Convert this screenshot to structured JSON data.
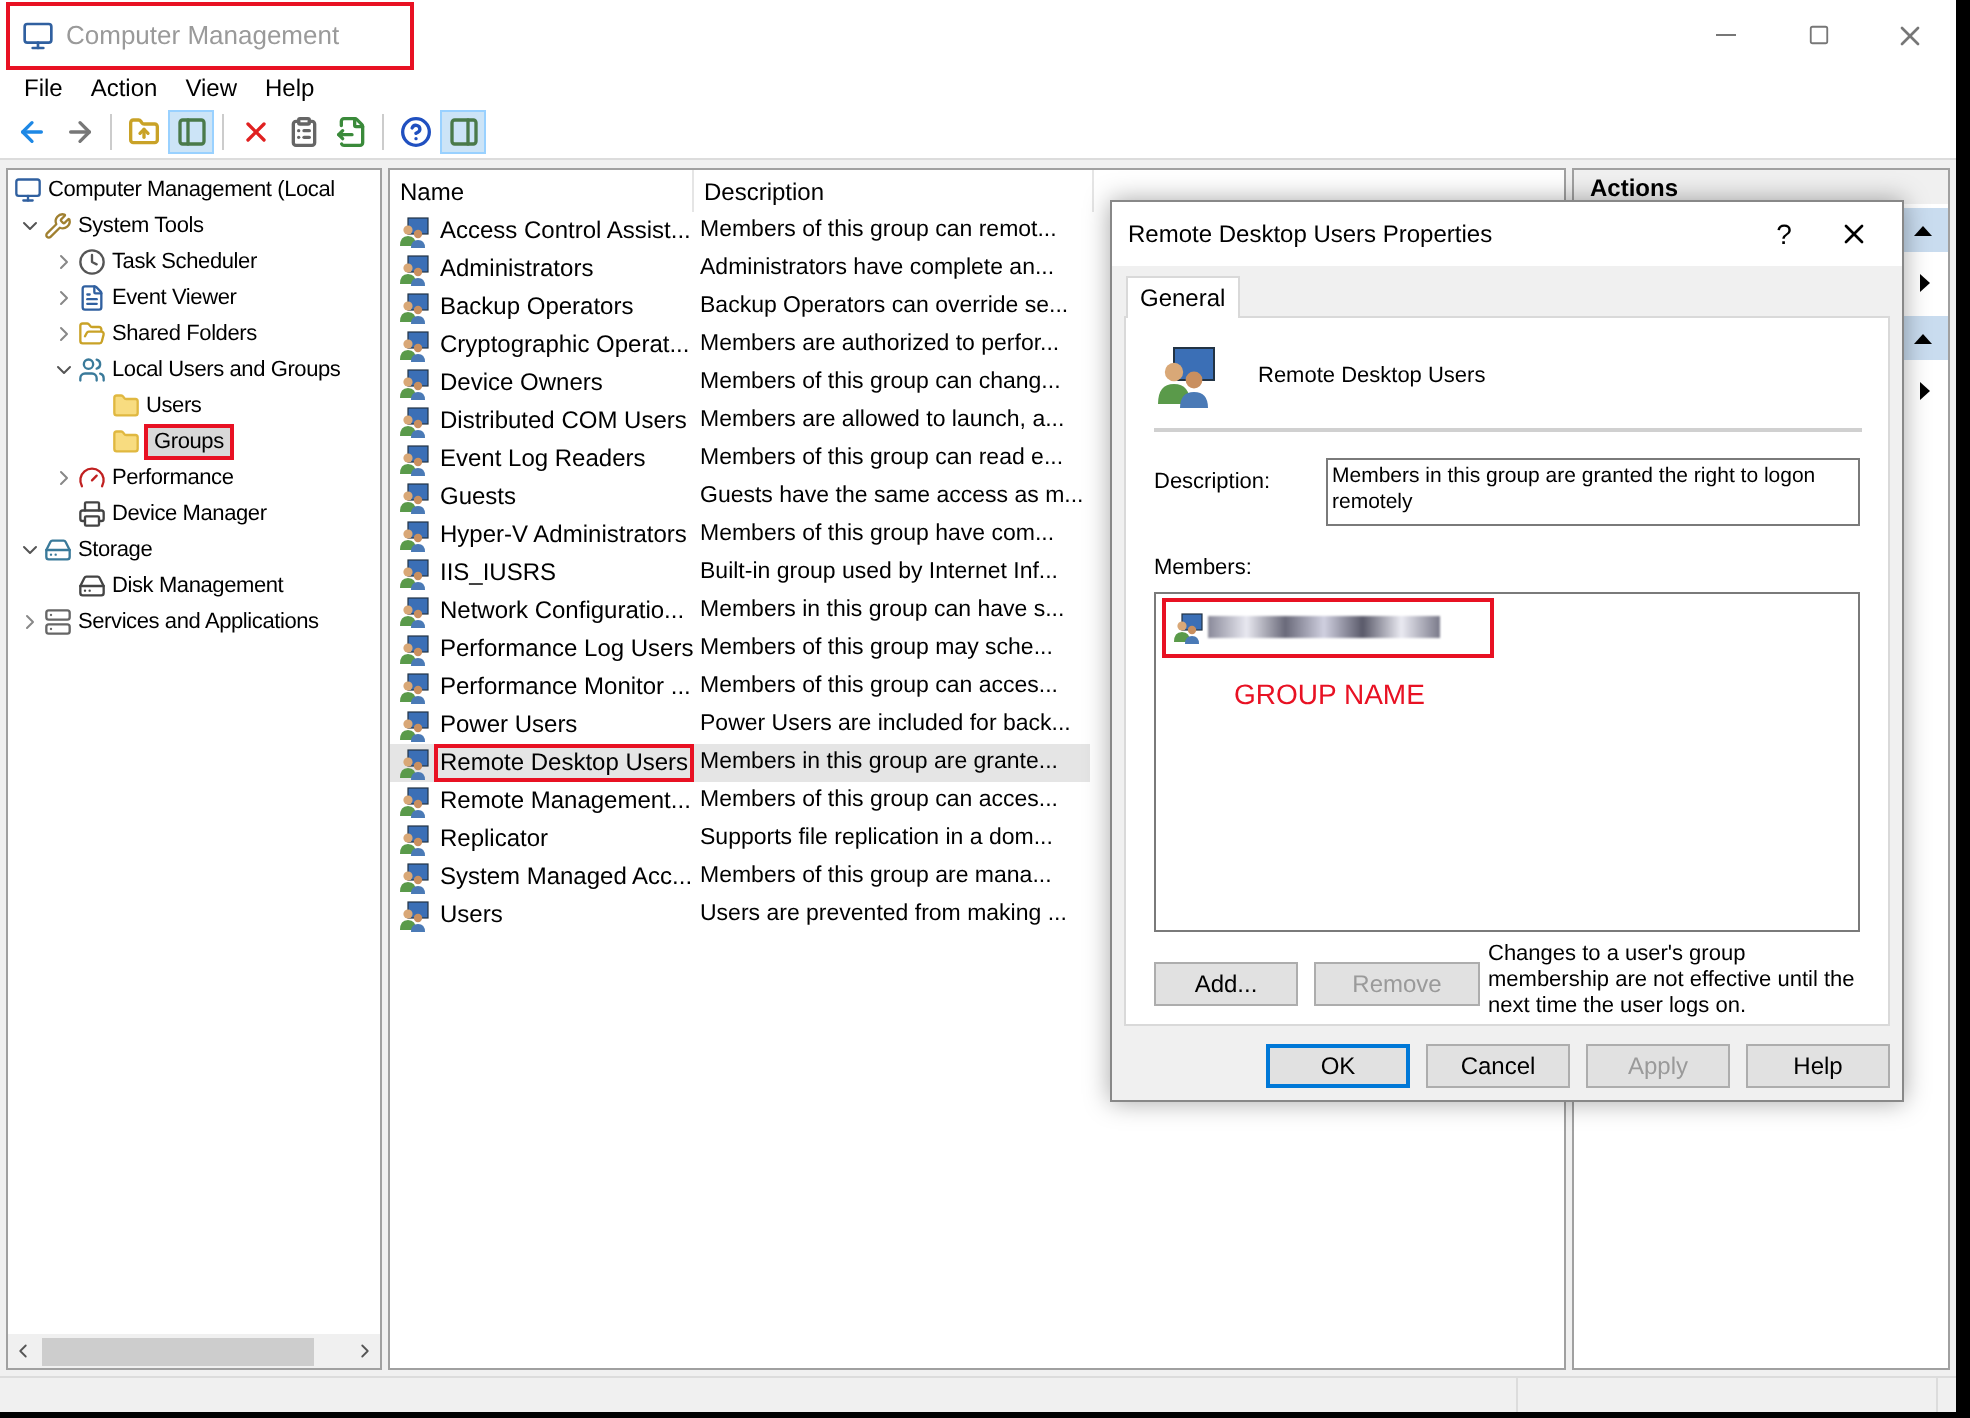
{
  "window": {
    "title": "Computer Management",
    "title_highlighted": true
  },
  "menu": [
    "File",
    "Action",
    "View",
    "Help"
  ],
  "toolbar": [
    {
      "kind": "back",
      "pressed": false
    },
    {
      "kind": "forward",
      "pressed": false
    },
    {
      "kind": "sep"
    },
    {
      "kind": "up",
      "pressed": false
    },
    {
      "kind": "tree",
      "pressed": true
    },
    {
      "kind": "sep"
    },
    {
      "kind": "delete",
      "pressed": false
    },
    {
      "kind": "properties",
      "pressed": false
    },
    {
      "kind": "export",
      "pressed": false
    },
    {
      "kind": "sep"
    },
    {
      "kind": "help",
      "pressed": false
    },
    {
      "kind": "pane",
      "pressed": true
    }
  ],
  "tree": [
    {
      "label": "Computer Management (Local",
      "kind": "computer",
      "selected": false,
      "highlighted": false,
      "children": [
        {
          "label": "System Tools",
          "kind": "tools",
          "expanded": true,
          "selected": false,
          "highlighted": false,
          "children": [
            {
              "label": "Task Scheduler",
              "kind": "clock",
              "expanded": false,
              "selected": false,
              "highlighted": false
            },
            {
              "label": "Event Viewer",
              "kind": "log",
              "expanded": false,
              "selected": false,
              "highlighted": false
            },
            {
              "label": "Shared Folders",
              "kind": "share",
              "expanded": false,
              "selected": false,
              "highlighted": false
            },
            {
              "label": "Local Users and Groups",
              "kind": "users",
              "expanded": true,
              "selected": false,
              "highlighted": false,
              "children": [
                {
                  "label": "Users",
                  "kind": "folder",
                  "selected": false,
                  "highlighted": false
                },
                {
                  "label": "Groups",
                  "kind": "folder",
                  "selected": true,
                  "highlighted": true
                }
              ]
            },
            {
              "label": "Performance",
              "kind": "gauge",
              "expanded": false,
              "selected": false,
              "highlighted": false
            },
            {
              "label": "Device Manager",
              "kind": "device",
              "selected": false,
              "highlighted": false
            }
          ]
        },
        {
          "label": "Storage",
          "kind": "storage",
          "expanded": true,
          "selected": false,
          "highlighted": false,
          "children": [
            {
              "label": "Disk Management",
              "kind": "disk",
              "selected": false,
              "highlighted": false
            }
          ]
        },
        {
          "label": "Services and Applications",
          "kind": "services",
          "expanded": false,
          "selected": false,
          "highlighted": false
        }
      ]
    }
  ],
  "table": {
    "columns": [
      "Name",
      "Description"
    ],
    "rows": [
      {
        "name": "Access Control Assist...",
        "description": "Members of this group can remot...",
        "selected": false,
        "highlighted": false
      },
      {
        "name": "Administrators",
        "description": "Administrators have complete an...",
        "selected": false,
        "highlighted": false
      },
      {
        "name": "Backup Operators",
        "description": "Backup Operators can override se...",
        "selected": false,
        "highlighted": false
      },
      {
        "name": "Cryptographic Operat...",
        "description": "Members are authorized to perfor...",
        "selected": false,
        "highlighted": false
      },
      {
        "name": "Device Owners",
        "description": "Members of this group can chang...",
        "selected": false,
        "highlighted": false
      },
      {
        "name": "Distributed COM Users",
        "description": "Members are allowed to launch, a...",
        "selected": false,
        "highlighted": false
      },
      {
        "name": "Event Log Readers",
        "description": "Members of this group can read e...",
        "selected": false,
        "highlighted": false
      },
      {
        "name": "Guests",
        "description": "Guests have the same access as m...",
        "selected": false,
        "highlighted": false
      },
      {
        "name": "Hyper-V Administrators",
        "description": "Members of this group have com...",
        "selected": false,
        "highlighted": false
      },
      {
        "name": "IIS_IUSRS",
        "description": "Built-in group used by Internet Inf...",
        "selected": false,
        "highlighted": false
      },
      {
        "name": "Network Configuratio...",
        "description": "Members in this group can have s...",
        "selected": false,
        "highlighted": false
      },
      {
        "name": "Performance Log Users",
        "description": "Members of this group may sche...",
        "selected": false,
        "highlighted": false
      },
      {
        "name": "Performance Monitor ...",
        "description": "Members of this group can acces...",
        "selected": false,
        "highlighted": false
      },
      {
        "name": "Power Users",
        "description": "Power Users are included for back...",
        "selected": false,
        "highlighted": false
      },
      {
        "name": "Remote Desktop Users",
        "description": "Members in this group are grante...",
        "selected": true,
        "highlighted": true
      },
      {
        "name": "Remote Management...",
        "description": "Members of this group can acces...",
        "selected": false,
        "highlighted": false
      },
      {
        "name": "Replicator",
        "description": "Supports file replication in a dom...",
        "selected": false,
        "highlighted": false
      },
      {
        "name": "System Managed Acc...",
        "description": "Members of this group are mana...",
        "selected": false,
        "highlighted": false
      },
      {
        "name": "Users",
        "description": "Users are prevented from making ...",
        "selected": false,
        "highlighted": false
      }
    ]
  },
  "actions": {
    "title": "Actions",
    "sections": [
      {
        "expanded": true
      },
      {
        "expanded": true
      }
    ]
  },
  "dialog": {
    "title": "Remote Desktop Users Properties",
    "help": "?",
    "tabs": [
      {
        "label": "General",
        "selected": true
      }
    ],
    "group_name": "Remote Desktop Users",
    "description_label": "Description:",
    "description": "Members in this group are granted the right to logon remotely",
    "members_label": "Members:",
    "members": [
      {
        "highlighted": true
      }
    ],
    "annotation": "GROUP NAME",
    "note": "Changes to a user's group membership are not effective until the next time the user logs on.",
    "list_buttons": [
      {
        "label": "Add...",
        "disabled": false
      },
      {
        "label": "Remove",
        "disabled": true
      }
    ],
    "buttons": [
      {
        "label": "OK",
        "disabled": false,
        "default": true
      },
      {
        "label": "Cancel",
        "disabled": false,
        "default": false
      },
      {
        "label": "Apply",
        "disabled": true,
        "default": false
      },
      {
        "label": "Help",
        "disabled": false,
        "default": false
      }
    ]
  }
}
